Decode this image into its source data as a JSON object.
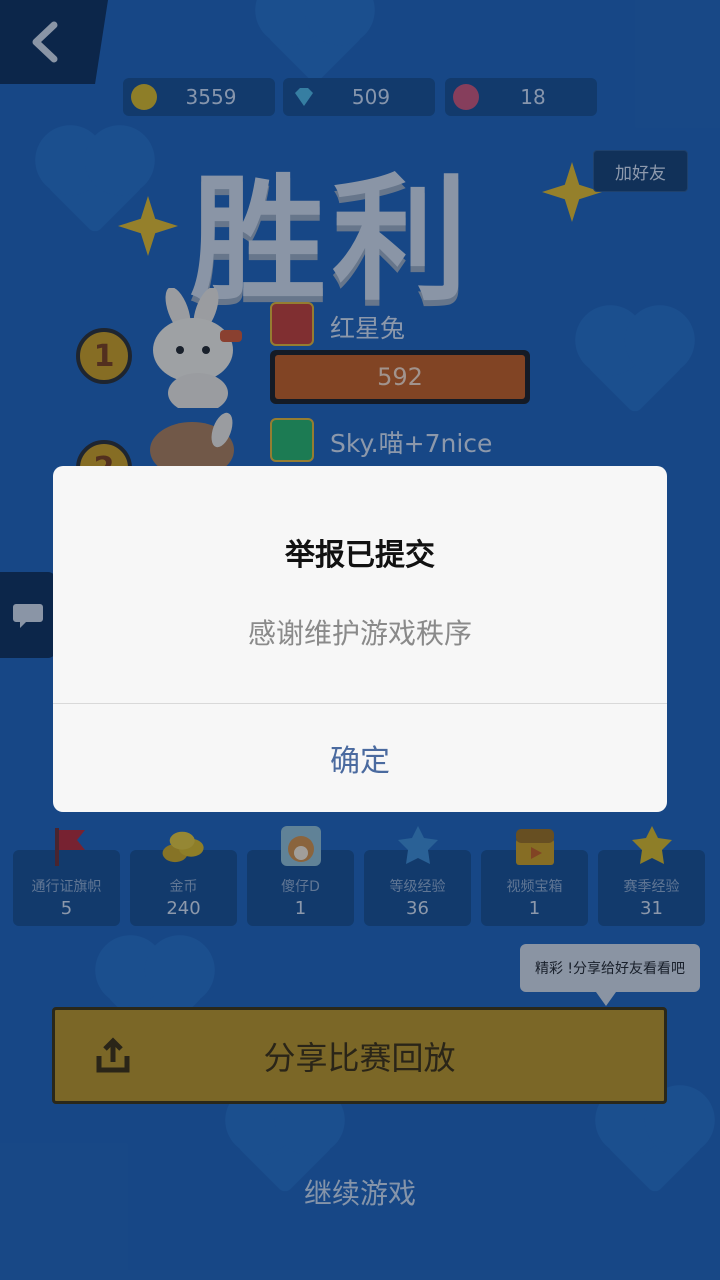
{
  "currencies": [
    {
      "icon": "gold-coin-icon",
      "value": "3559",
      "color": "#d6b21e"
    },
    {
      "icon": "diamond-icon",
      "value": "509",
      "color": "#4fb3d9"
    },
    {
      "icon": "flower-icon",
      "value": "18",
      "color": "#c9506e"
    }
  ],
  "result": {
    "title": "胜利"
  },
  "add_friend_label": "加好友",
  "players": [
    {
      "rank": "1",
      "name": "红星兔",
      "score": "592"
    },
    {
      "rank": "2",
      "name": "Sky.喵+7nice"
    }
  ],
  "rewards": [
    {
      "icon": "pass-flag-icon",
      "label": "通行证旗帜",
      "value": "5"
    },
    {
      "icon": "gold-coins-icon",
      "label": "金币",
      "value": "240"
    },
    {
      "icon": "shiba-icon",
      "label": "傻仔D",
      "value": "1"
    },
    {
      "icon": "level-star-icon",
      "label": "等级经验",
      "value": "36"
    },
    {
      "icon": "video-chest-icon",
      "label": "视频宝箱",
      "value": "1"
    },
    {
      "icon": "season-star-icon",
      "label": "赛季经验",
      "value": "31"
    }
  ],
  "tooltip": "精彩 !分享给好友看看吧",
  "share_button": "分享比赛回放",
  "continue_label": "继续游戏",
  "dialog": {
    "title": "举报已提交",
    "message": "感谢维护游戏秩序",
    "confirm": "确定"
  },
  "colors": {
    "background": "#1f5fae",
    "accent_gold": "#b8901c",
    "score_bar": "#c25a18",
    "dialog_confirm": "#4a6a9f"
  }
}
